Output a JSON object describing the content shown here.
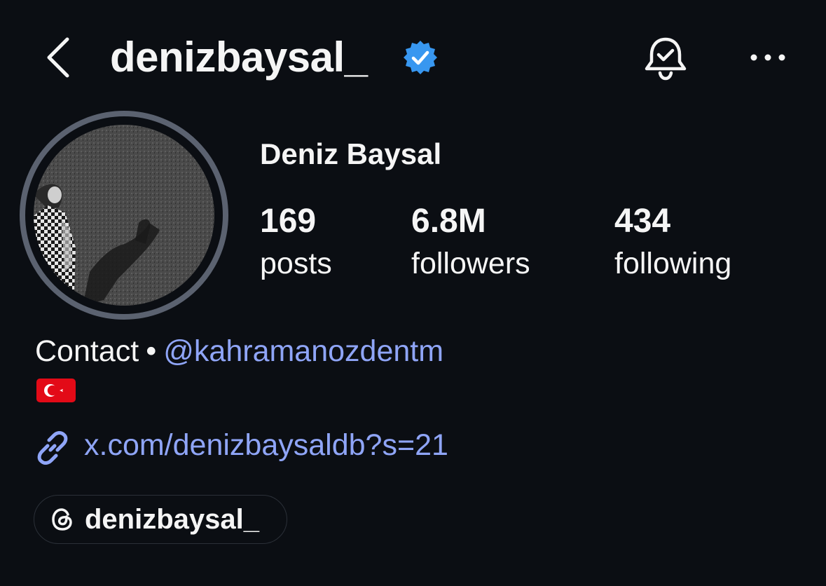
{
  "header": {
    "username": "denizbaysal_",
    "verified_icon": "verified-badge-icon",
    "back_icon": "chevron-left-icon",
    "notification_icon": "bell-check-icon",
    "more_icon": "more-horizontal-icon"
  },
  "profile": {
    "display_name": "Deniz Baysal",
    "stats": {
      "posts": {
        "value": "169",
        "label": "posts"
      },
      "followers": {
        "value": "6.8M",
        "label": "followers"
      },
      "following": {
        "value": "434",
        "label": "following"
      }
    },
    "bio": {
      "contact_label": "Contact",
      "separator": "•",
      "contact_handle": "@kahramanozdentm",
      "flag_icon": "turkey-flag-icon"
    },
    "website": "x.com/denizbaysaldb?s=21",
    "threads_handle": "denizbaysal_"
  },
  "colors": {
    "background": "#0b0e13",
    "text": "#f5f5f5",
    "link": "#8fa5f7",
    "verified": "#3897f0",
    "avatar_ring": "#5b6270"
  }
}
